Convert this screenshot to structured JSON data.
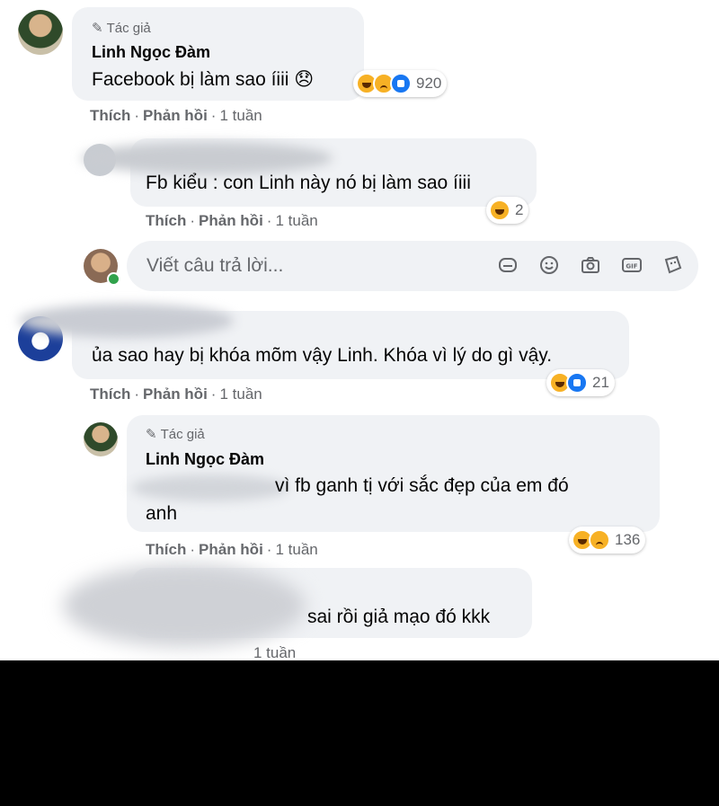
{
  "author_tag": "Tác giả",
  "actions": {
    "like": "Thích",
    "reply": "Phản hồi",
    "dot": "·"
  },
  "comments": [
    {
      "name": "Linh Ngọc Đàm",
      "text": "Facebook bị làm sao íiii 😞",
      "reactions": "920",
      "time": "1 tuần"
    },
    {
      "text": "Fb kiểu : con Linh này nó bị làm sao íiii",
      "reactions": "2",
      "time": "1 tuần"
    },
    {
      "text": "ủa sao hay bị khóa mõm vậy Linh. Khóa vì lý do gì vậy.",
      "reactions": "21",
      "time": "1 tuần"
    },
    {
      "name": "Linh Ngọc Đàm",
      "text_line1": "vì fb ganh tị với sắc đẹp của em đó",
      "text_line2": "anh",
      "reactions": "136",
      "time": "1 tuần"
    },
    {
      "text": "sai rồi giả mạo đó kkk",
      "time": "1 tuần"
    }
  ],
  "reply_input": {
    "placeholder": "Viết câu trả lời..."
  },
  "reply_tools": [
    "sticker-icon",
    "emoji-icon",
    "camera-icon",
    "gif-icon",
    "avatar-sticker-icon"
  ]
}
